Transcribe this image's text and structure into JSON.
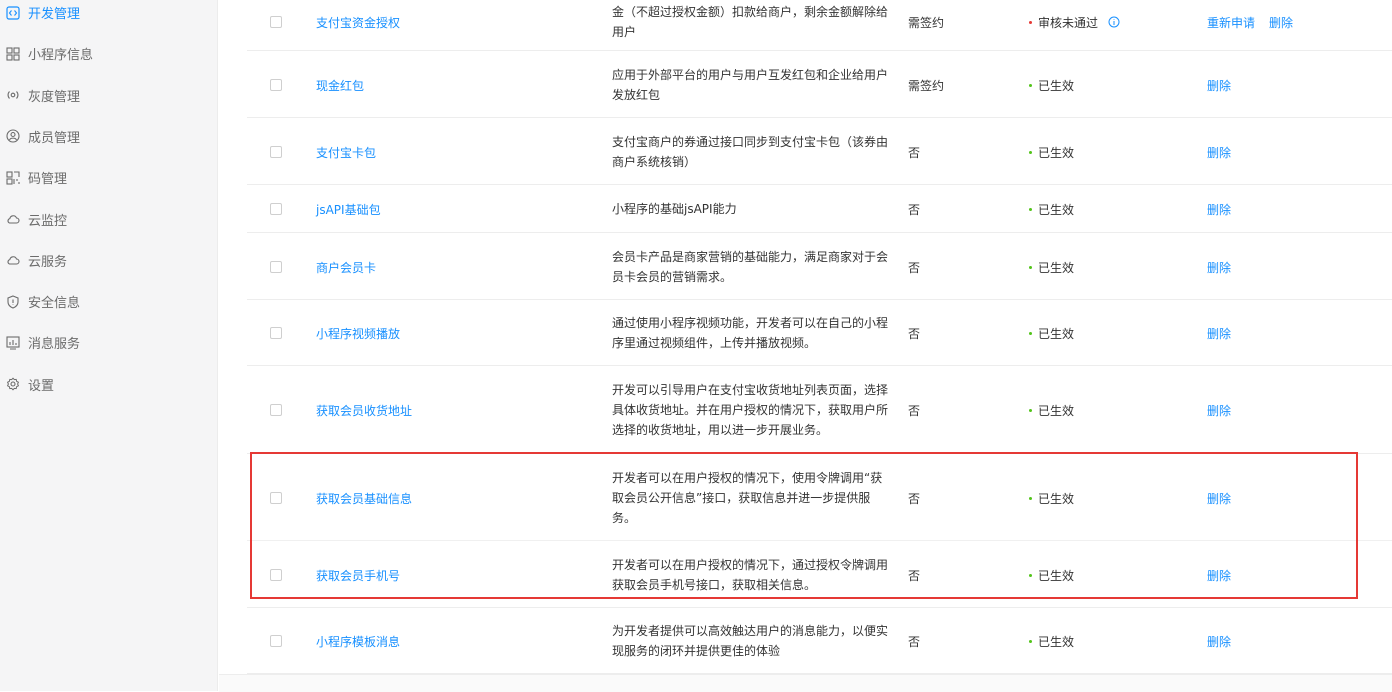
{
  "sidebar": {
    "items": [
      {
        "label": "开发管理",
        "icon": "code-icon",
        "active": true
      },
      {
        "label": "小程序信息",
        "icon": "grid-icon"
      },
      {
        "label": "灰度管理",
        "icon": "broadcast-icon"
      },
      {
        "label": "成员管理",
        "icon": "user-icon"
      },
      {
        "label": "码管理",
        "icon": "qrcode-icon"
      },
      {
        "label": "云监控",
        "icon": "cloud-icon"
      },
      {
        "label": "云服务",
        "icon": "cloud-icon"
      },
      {
        "label": "安全信息",
        "icon": "shield-icon"
      },
      {
        "label": "消息服务",
        "icon": "chart-icon"
      },
      {
        "label": "设置",
        "icon": "gear-icon"
      }
    ]
  },
  "colors": {
    "accent": "#1890ff",
    "error": "#e53935",
    "success": "#52c41a"
  },
  "table": {
    "rows": [
      {
        "name": "支付宝资金授权",
        "desc_lines": [
          "金（不超过授权金额）扣款给商户，剩余金额解除给",
          "用户"
        ],
        "sign": "需签约",
        "status": "审核未通过",
        "status_type": "error",
        "ops": [
          "重新申请",
          "删除"
        ]
      },
      {
        "name": "现金红包",
        "desc_lines": [
          "应用于外部平台的用户与用户互发红包和企业给用户",
          "发放红包"
        ],
        "sign": "需签约",
        "status": "已生效",
        "status_type": "success",
        "ops": [
          "删除"
        ]
      },
      {
        "name": "支付宝卡包",
        "desc_lines": [
          "支付宝商户的券通过接口同步到支付宝卡包（该券由",
          "商户系统核销）"
        ],
        "sign": "否",
        "status": "已生效",
        "status_type": "success",
        "ops": [
          "删除"
        ]
      },
      {
        "name": "jsAPI基础包",
        "desc_lines": [
          "小程序的基础jsAPI能力"
        ],
        "sign": "否",
        "status": "已生效",
        "status_type": "success",
        "ops": [
          "删除"
        ]
      },
      {
        "name": "商户会员卡",
        "desc_lines": [
          "会员卡产品是商家营销的基础能力，满足商家对于会",
          "员卡会员的营销需求。"
        ],
        "sign": "否",
        "status": "已生效",
        "status_type": "success",
        "ops": [
          "删除"
        ]
      },
      {
        "name": "小程序视频播放",
        "desc_lines": [
          "通过使用小程序视频功能，开发者可以在自己的小程",
          "序里通过视频组件，上传并播放视频。"
        ],
        "sign": "否",
        "status": "已生效",
        "status_type": "success",
        "ops": [
          "删除"
        ]
      },
      {
        "name": "获取会员收货地址",
        "desc_lines": [
          "开发可以引导用户在支付宝收货地址列表页面，选择",
          "具体收货地址。并在用户授权的情况下，获取用户所",
          "选择的收货地址，用以进一步开展业务。"
        ],
        "sign": "否",
        "status": "已生效",
        "status_type": "success",
        "ops": [
          "删除"
        ]
      },
      {
        "name": "获取会员基础信息",
        "desc_lines": [
          "开发者可以在用户授权的情况下，使用令牌调用“获",
          "取会员公开信息”接口，获取信息并进一步提供服",
          "务。"
        ],
        "sign": "否",
        "status": "已生效",
        "status_type": "success",
        "ops": [
          "删除"
        ]
      },
      {
        "name": "获取会员手机号",
        "desc_lines": [
          "开发者可以在用户授权的情况下，通过授权令牌调用",
          "获取会员手机号接口，获取相关信息。"
        ],
        "sign": "否",
        "status": "已生效",
        "status_type": "success",
        "ops": [
          "删除"
        ]
      },
      {
        "name": "小程序模板消息",
        "desc_lines": [
          "为开发者提供可以高效触达用户的消息能力，以便实",
          "现服务的闭环并提供更佳的体验"
        ],
        "sign": "否",
        "status": "已生效",
        "status_type": "success",
        "ops": [
          "删除"
        ]
      }
    ]
  }
}
